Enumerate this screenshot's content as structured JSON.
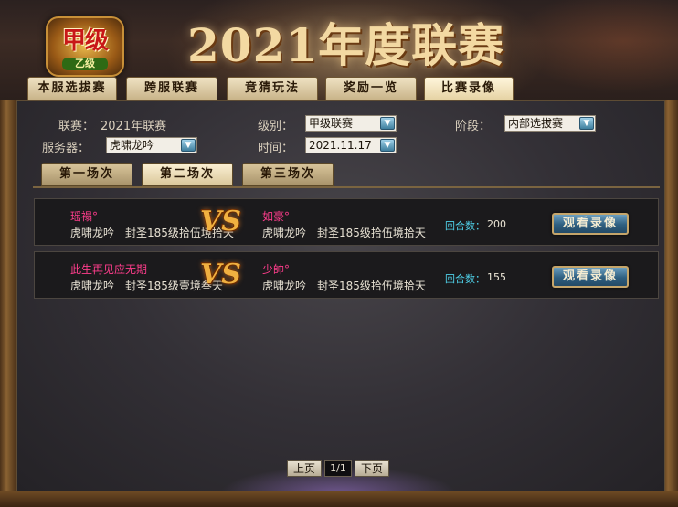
{
  "header": {
    "logo_main": "甲级",
    "logo_sub": "乙级",
    "title": "2021年度联赛"
  },
  "main_tabs": [
    {
      "label": "本服选拔赛"
    },
    {
      "label": "跨服联赛"
    },
    {
      "label": "竞猜玩法"
    },
    {
      "label": "奖励一览"
    },
    {
      "label": "比赛录像",
      "active": true
    }
  ],
  "filters": {
    "league_label": "联赛：",
    "league_value": "2021年联赛",
    "level_label": "级别：",
    "level_value": "甲级联赛",
    "stage_label": "阶段：",
    "stage_value": "内部选拔赛",
    "server_label": "服务器：",
    "server_value": "虎啸龙吟",
    "time_label": "时间：",
    "time_value": "2021.11.17"
  },
  "sub_tabs": [
    {
      "label": "第一场次"
    },
    {
      "label": "第二场次",
      "active": true
    },
    {
      "label": "第三场次"
    }
  ],
  "matches": [
    {
      "p1_name": "瑶褟°",
      "p1_server": "虎啸龙吟",
      "p1_rank": "封圣185级拾伍境拾天",
      "vs": "VS",
      "p2_name": "如豪°",
      "p2_server": "虎啸龙吟",
      "p2_rank": "封圣185级拾伍境拾天",
      "rounds_label": "回合数：",
      "rounds": "200",
      "watch_label": "观看录像"
    },
    {
      "p1_name": "此生再见应无期",
      "p1_server": "虎啸龙吟",
      "p1_rank": "封圣185级壹境叁天",
      "vs": "VS",
      "p2_name": "少帥°",
      "p2_server": "虎啸龙吟",
      "p2_rank": "封圣185级拾伍境拾天",
      "rounds_label": "回合数：",
      "rounds": "155",
      "watch_label": "观看录像"
    }
  ],
  "pagination": {
    "prev_label": "上页",
    "page": "1/1",
    "next_label": "下页"
  },
  "colors": {
    "player_name": "#ff3d8c",
    "rounds_label": "#4fd0e8",
    "vs": "#f0b040"
  }
}
